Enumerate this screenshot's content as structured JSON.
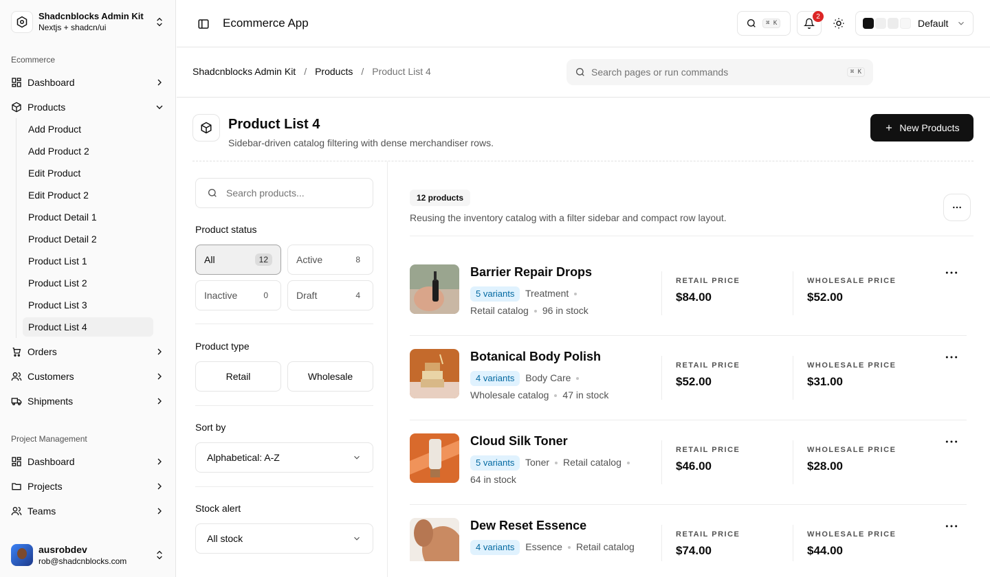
{
  "brand": {
    "title": "Shadcnblocks Admin Kit",
    "subtitle": "Nextjs + shadcn/ui"
  },
  "sidebar": {
    "group1": "Ecommerce",
    "dashboard": "Dashboard",
    "products": "Products",
    "sub": [
      "Add Product",
      "Add Product 2",
      "Edit Product",
      "Edit Product 2",
      "Product Detail 1",
      "Product Detail 2",
      "Product List 1",
      "Product List 2",
      "Product List 3",
      "Product List 4"
    ],
    "orders": "Orders",
    "customers": "Customers",
    "shipments": "Shipments",
    "group2": "Project Management",
    "pm_dashboard": "Dashboard",
    "projects": "Projects",
    "teams": "Teams"
  },
  "user": {
    "name": "ausrobdev",
    "email": "rob@shadcnblocks.com"
  },
  "topbar": {
    "title": "Ecommerce App",
    "shortcut": "⌘ K",
    "notifications": "2",
    "theme": "Default"
  },
  "breadcrumb": {
    "root": "Shadcnblocks Admin Kit",
    "section": "Products",
    "current": "Product List 4"
  },
  "command": {
    "placeholder": "Search pages or run commands",
    "shortcut": "⌘ K"
  },
  "page": {
    "title": "Product List 4",
    "subtitle": "Sidebar-driven catalog filtering with dense merchandiser rows.",
    "new_button": "New Products"
  },
  "filters": {
    "search_placeholder": "Search products...",
    "status_label": "Product status",
    "status": [
      {
        "label": "All",
        "count": "12"
      },
      {
        "label": "Active",
        "count": "8"
      },
      {
        "label": "Inactive",
        "count": "0"
      },
      {
        "label": "Draft",
        "count": "4"
      }
    ],
    "type_label": "Product type",
    "types": [
      "Retail",
      "Wholesale"
    ],
    "sort_label": "Sort by",
    "sort_value": "Alphabetical: A-Z",
    "stock_label": "Stock alert",
    "stock_value": "All stock"
  },
  "list": {
    "count": "12 products",
    "description": "Reusing the inventory catalog with a filter sidebar and compact row layout.",
    "retail_label": "RETAIL PRICE",
    "wholesale_label": "WHOLESALE PRICE",
    "products": [
      {
        "name": "Barrier Repair Drops",
        "variants": "5 variants",
        "category": "Treatment",
        "catalog": "Retail catalog",
        "stock": "96 in stock",
        "retail": "$84.00",
        "wholesale": "$52.00"
      },
      {
        "name": "Botanical Body Polish",
        "variants": "4 variants",
        "category": "Body Care",
        "catalog": "Wholesale catalog",
        "stock": "47 in stock",
        "retail": "$52.00",
        "wholesale": "$31.00"
      },
      {
        "name": "Cloud Silk Toner",
        "variants": "5 variants",
        "category": "Toner",
        "catalog": "Retail catalog",
        "stock": "64 in stock",
        "retail": "$46.00",
        "wholesale": "$28.00"
      },
      {
        "name": "Dew Reset Essence",
        "variants": "4 variants",
        "category": "Essence",
        "catalog": "Retail catalog",
        "stock": "",
        "retail": "$74.00",
        "wholesale": "$44.00"
      }
    ]
  }
}
